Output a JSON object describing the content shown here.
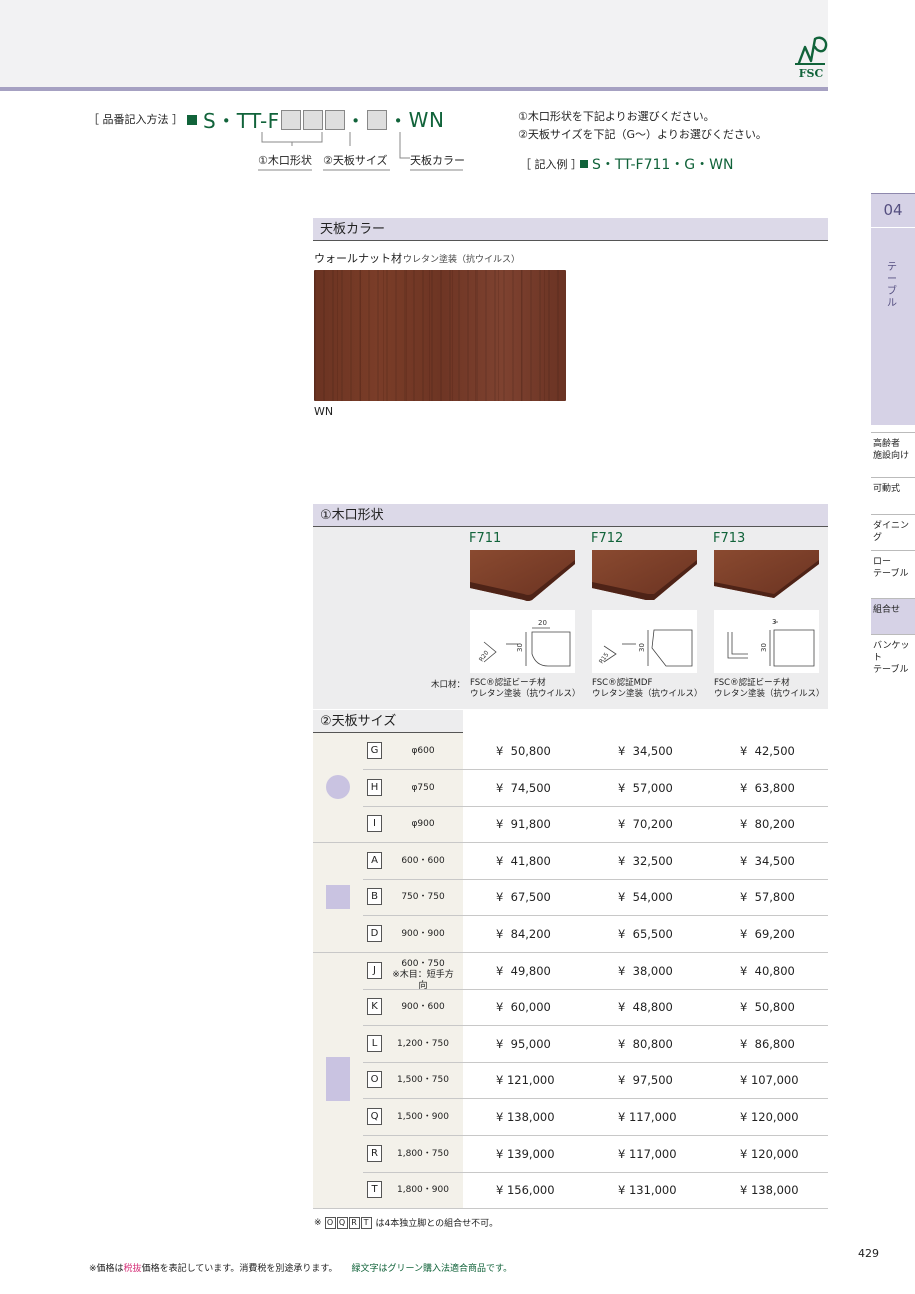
{
  "header": {
    "order_label": "［ 品番記入方法 ］",
    "model_prefix": "S・TT-F",
    "model_dot1": "・",
    "model_dot2": "・",
    "model_suffix": "WN",
    "bracket_labels": [
      "①木口形状",
      "②天板サイズ",
      "天板カラー"
    ],
    "notes": [
      "①木口形状を下記よりお選びください。",
      "②天板サイズを下記（G～）よりお選びください。"
    ],
    "example_label": "［ 記入例 ］",
    "example_value": "S・TT-F711・G・WN",
    "logo_text": "FSC"
  },
  "side_tabs": {
    "number": "04",
    "main_label": "テーブル",
    "items": [
      {
        "label": "高齢者\n施設向け",
        "active": false
      },
      {
        "label": "可動式",
        "active": false
      },
      {
        "label": "ダイニング",
        "active": false
      },
      {
        "label": "ロー\nテーブル",
        "active": false
      },
      {
        "label": "組合せ",
        "active": true
      },
      {
        "label": "バンケット\nテーブル",
        "active": false
      }
    ]
  },
  "color_section": {
    "heading": "天板カラー",
    "wood_title": "ウォールナット材",
    "wood_sub": "ウレタン塗装（抗ウイルス）",
    "code": "WN",
    "swatch_color": "#743a26"
  },
  "edge_section": {
    "heading": "①木口形状",
    "material_label": "木口材：",
    "types": [
      {
        "code": "F711",
        "dim_a": "20",
        "dim_b": "30",
        "dim_r": "R20",
        "material_1": "FSC®認証ビーチ材",
        "material_2": "ウレタン塗装（抗ウイルス）"
      },
      {
        "code": "F712",
        "dim_a": "30",
        "dim_r": "R15",
        "material_1": "FSC®認証MDF",
        "material_2": "ウレタン塗装（抗ウイルス）"
      },
      {
        "code": "F713",
        "dim_a": "3",
        "dim_b": "30",
        "material_1": "FSC®認証ビーチ材",
        "material_2": "ウレタン塗装（抗ウイルス）"
      }
    ]
  },
  "size_section": {
    "heading": "②天板サイズ",
    "rows": [
      {
        "code": "G",
        "dim": "φ600",
        "dim_note": "",
        "prices": [
          "¥  50,800",
          "¥  34,500",
          "¥  42,500"
        ]
      },
      {
        "code": "H",
        "dim": "φ750",
        "dim_note": "",
        "prices": [
          "¥  74,500",
          "¥  57,000",
          "¥  63,800"
        ]
      },
      {
        "code": "I",
        "dim": "φ900",
        "dim_note": "",
        "prices": [
          "¥  91,800",
          "¥  70,200",
          "¥  80,200"
        ]
      },
      {
        "code": "A",
        "dim": "600・600",
        "dim_note": "",
        "prices": [
          "¥  41,800",
          "¥  32,500",
          "¥  34,500"
        ]
      },
      {
        "code": "B",
        "dim": "750・750",
        "dim_note": "",
        "prices": [
          "¥  67,500",
          "¥  54,000",
          "¥  57,800"
        ]
      },
      {
        "code": "D",
        "dim": "900・900",
        "dim_note": "",
        "prices": [
          "¥  84,200",
          "¥  65,500",
          "¥  69,200"
        ]
      },
      {
        "code": "J",
        "dim": "600・750",
        "dim_note": "※木目：短手方向",
        "prices": [
          "¥  49,800",
          "¥  38,000",
          "¥  40,800"
        ]
      },
      {
        "code": "K",
        "dim": "900・600",
        "dim_note": "",
        "prices": [
          "¥  60,000",
          "¥  48,800",
          "¥  50,800"
        ]
      },
      {
        "code": "L",
        "dim": "1,200・750",
        "dim_note": "",
        "prices": [
          "¥  95,000",
          "¥  80,800",
          "¥  86,800"
        ]
      },
      {
        "code": "O",
        "dim": "1,500・750",
        "dim_note": "",
        "prices": [
          "¥ 121,000",
          "¥  97,500",
          "¥ 107,000"
        ]
      },
      {
        "code": "Q",
        "dim": "1,500・900",
        "dim_note": "",
        "prices": [
          "¥ 138,000",
          "¥ 117,000",
          "¥ 120,000"
        ]
      },
      {
        "code": "R",
        "dim": "1,800・750",
        "dim_note": "",
        "prices": [
          "¥ 139,000",
          "¥ 117,000",
          "¥ 120,000"
        ]
      },
      {
        "code": "T",
        "dim": "1,800・900",
        "dim_note": "",
        "prices": [
          "¥ 156,000",
          "¥ 131,000",
          "¥ 138,000"
        ]
      }
    ],
    "footnote_prefix": "※",
    "footnote_codes": [
      "O",
      "Q",
      "R",
      "T"
    ],
    "footnote_text": "は4本独立脚との組合せ不可。"
  },
  "footer": {
    "page_number": "429",
    "note_1": "※価格は",
    "note_pink": "税抜",
    "note_2": "価格を表記しています。消費税を別途承ります。",
    "note_green": "緑文字はグリーン購入法適合商品です。"
  },
  "colors": {
    "accent_green": "#11633a",
    "lavender": "#dcd9e8",
    "shape": "#c9c3e1",
    "pink": "#d6337a"
  }
}
